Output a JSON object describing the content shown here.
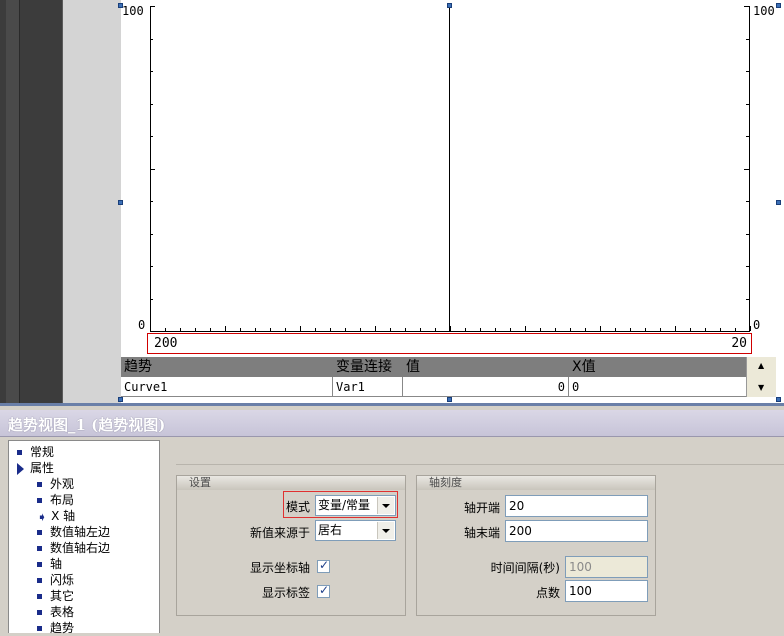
{
  "chart": {
    "y_left_top": "100",
    "y_left_bottom": "0",
    "y_right_top": "100",
    "y_right_bottom": "0",
    "x_left": "200",
    "x_right": "20"
  },
  "table": {
    "headers": [
      "趋势",
      "变量连接",
      "值",
      "X值"
    ],
    "rows": [
      {
        "trend": "Curve1",
        "var": "Var1",
        "value": "0",
        "x": "0"
      }
    ]
  },
  "panel": {
    "title": "趋势视图_1 (趋势视图)"
  },
  "nav": {
    "items": [
      {
        "label": "常规",
        "level": 0,
        "marker": "bullet"
      },
      {
        "label": "属性",
        "level": 0,
        "marker": "triangle"
      },
      {
        "label": "外观",
        "level": 1,
        "marker": "bullet"
      },
      {
        "label": "布局",
        "level": 1,
        "marker": "bullet"
      },
      {
        "label": "X 轴",
        "level": 1,
        "marker": "selected-arrow"
      },
      {
        "label": "数值轴左边",
        "level": 1,
        "marker": "bullet"
      },
      {
        "label": "数值轴右边",
        "level": 1,
        "marker": "bullet"
      },
      {
        "label": "轴",
        "level": 1,
        "marker": "bullet"
      },
      {
        "label": "闪烁",
        "level": 1,
        "marker": "bullet"
      },
      {
        "label": "其它",
        "level": 1,
        "marker": "bullet"
      },
      {
        "label": "表格",
        "level": 1,
        "marker": "bullet"
      },
      {
        "label": "趋势",
        "level": 1,
        "marker": "bullet"
      }
    ]
  },
  "settings": {
    "group_title": "设置",
    "mode_label": "模式",
    "mode_value": "变量/常量",
    "source_label": "新值来源于",
    "source_value": "居右",
    "show_axis_label": "显示坐标轴",
    "show_axis_checked": true,
    "show_label_label": "显示标签",
    "show_label_checked": true
  },
  "scale": {
    "group_title": "轴刻度",
    "start_label": "轴开端",
    "start_value": "20",
    "end_label": "轴末端",
    "end_value": "200",
    "interval_label": "时间间隔(秒)",
    "interval_value": "100",
    "points_label": "点数",
    "points_value": "100"
  },
  "colors": {
    "highlight": "#e03030",
    "title_bar": "#c7c4d8",
    "nav_marker": "#1a2c8a"
  }
}
